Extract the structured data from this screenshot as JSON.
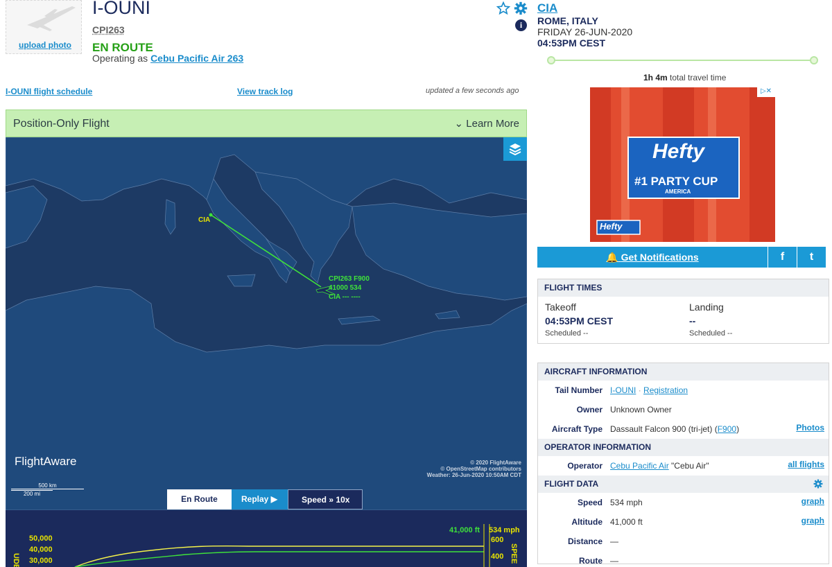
{
  "header": {
    "upload_photo": "upload photo",
    "tail_number": "I-OUNI",
    "ident": "CPI263",
    "status": "EN ROUTE",
    "operating_prefix": "Operating as",
    "operating_flight": "Cebu Pacific Air 263"
  },
  "links": {
    "schedule": "I-OUNI flight schedule",
    "track_log": "View track log",
    "updated": "updated a few seconds ago"
  },
  "destination": {
    "code": "CIA",
    "city": "ROME, ITALY",
    "date": "FRIDAY 26-JUN-2020",
    "time": "04:53PM CEST",
    "travel_time_bold": "1h 4m",
    "travel_time_suffix": "total travel time"
  },
  "banner": {
    "title": "Position-Only Flight",
    "learn_more": "Learn More"
  },
  "map": {
    "origin_label": "CIA",
    "aircraft_label_1": "CPI263 F900",
    "aircraft_label_2": "41000 534",
    "aircraft_label_3": "CIA --- ----",
    "credit_1": "© 2020 FlightAware",
    "credit_2": "© OpenStreetMap contributors",
    "credit_3": "Weather: 26-Jun-2020 10:50AM CDT",
    "logo": "FlightAware",
    "scale_km": "500 km",
    "scale_mi": "200 mi",
    "controls": {
      "route": "En Route",
      "replay": "Replay",
      "speed": "Speed",
      "speed_value": "10x"
    }
  },
  "altitude_chart": {
    "y_axis_label": "UDE (ft)",
    "y_ticks": [
      "50,000",
      "40,000",
      "30,000"
    ],
    "speed_axis_label": "SPEE",
    "speed_ticks": [
      "600",
      "400"
    ],
    "current_altitude": "41,000 ft",
    "current_speed": "534 mph"
  },
  "ad": {
    "brand": "Hefty",
    "tagline": "#1 PARTY CUP",
    "sub": "AMERICA"
  },
  "notifications": {
    "label": "Get Notifications",
    "facebook": "f",
    "twitter": "t"
  },
  "flight_times": {
    "header": "FLIGHT TIMES",
    "takeoff_label": "Takeoff",
    "takeoff_time": "04:53PM CEST",
    "takeoff_scheduled": "Scheduled --",
    "landing_label": "Landing",
    "landing_time": "--",
    "landing_scheduled": "Scheduled --"
  },
  "aircraft_info": {
    "header": "AIRCRAFT INFORMATION",
    "tail_label": "Tail Number",
    "tail_value": "I-OUNI",
    "registration": "Registration",
    "owner_label": "Owner",
    "owner_value": "Unknown Owner",
    "type_label": "Aircraft Type",
    "type_value": "Dassault Falcon 900 (tri-jet) (",
    "type_code": "F900",
    "type_close": ")",
    "photos": "Photos"
  },
  "operator_info": {
    "header": "OPERATOR INFORMATION",
    "operator_label": "Operator",
    "operator_value": "Cebu Pacific Air",
    "operator_alias": "\"Cebu Air\"",
    "all_flights": "all flights"
  },
  "flight_data": {
    "header": "FLIGHT DATA",
    "speed_label": "Speed",
    "speed_value": "534 mph",
    "altitude_label": "Altitude",
    "altitude_value": "41,000 ft",
    "distance_label": "Distance",
    "distance_value": "—",
    "route_label": "Route",
    "route_value": "—",
    "graph": "graph"
  },
  "colors": {
    "brand_navy": "#1b2a5c",
    "link_blue": "#1a8ccb",
    "status_green": "#26a017",
    "banner_green": "#c6efb4",
    "map_sea": "#1d3a64",
    "map_land": "#1f4a7c",
    "track_green": "#3fe23a",
    "label_yellow": "#e8e400"
  }
}
